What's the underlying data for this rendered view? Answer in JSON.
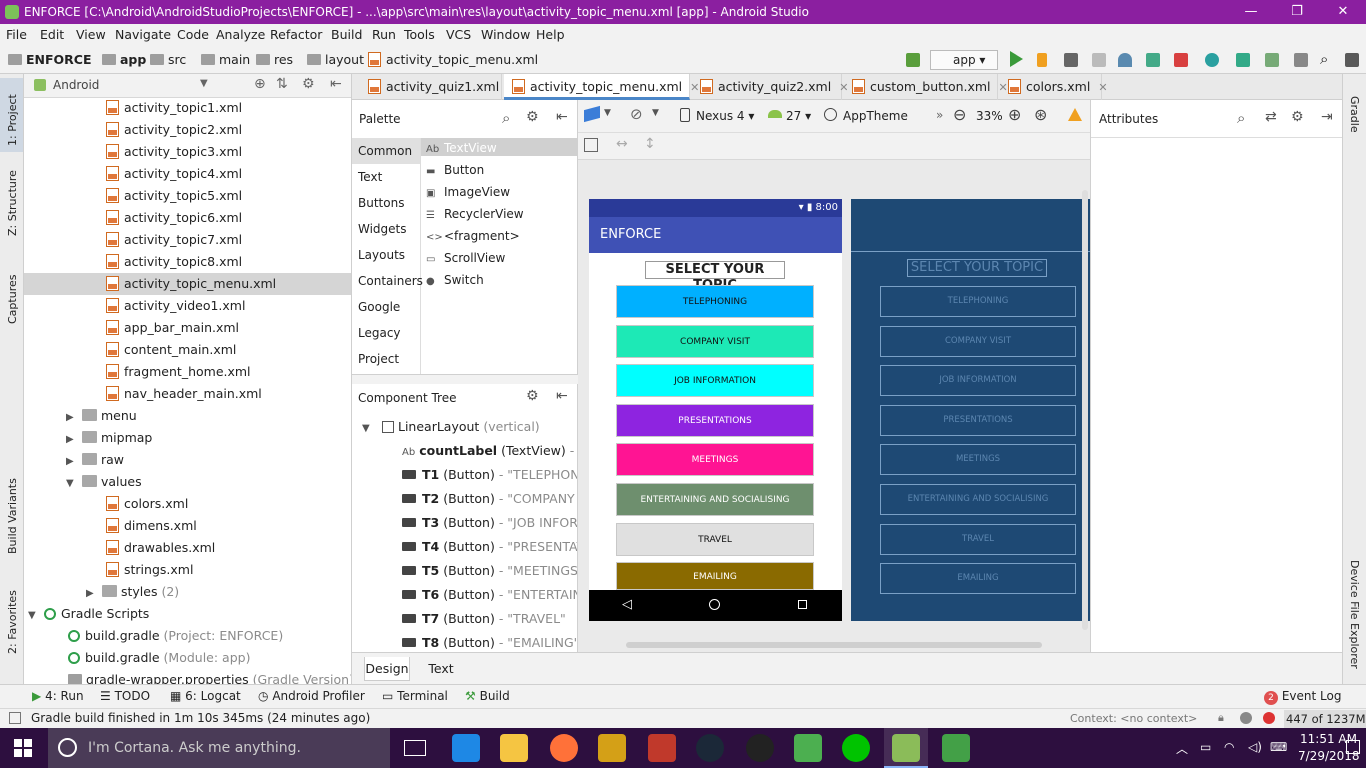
{
  "window": {
    "title": "ENFORCE [C:\\Android\\AndroidStudioProjects\\ENFORCE] - ...\\app\\src\\main\\res\\layout\\activity_topic_menu.xml [app] - Android Studio",
    "minimize": "—",
    "maximize": "❐",
    "close": "✕"
  },
  "menu": [
    "File",
    "Edit",
    "View",
    "Navigate",
    "Code",
    "Analyze",
    "Refactor",
    "Build",
    "Run",
    "Tools",
    "VCS",
    "Window",
    "Help"
  ],
  "breadcrumb": [
    "ENFORCE",
    "app",
    "src",
    "main",
    "res",
    "layout",
    "activity_topic_menu.xml"
  ],
  "run_config": "app",
  "left_strip": {
    "project": "1: Project",
    "structure": "Z: Structure",
    "captures": "Captures",
    "build_variants": "Build Variants",
    "favorites": "2: Favorites"
  },
  "right_strip": {
    "gradle": "Gradle",
    "device_explorer": "Device File Explorer"
  },
  "project": {
    "view": "Android",
    "files": [
      "activity_topic1.xml",
      "activity_topic2.xml",
      "activity_topic3.xml",
      "activity_topic4.xml",
      "activity_topic5.xml",
      "activity_topic6.xml",
      "activity_topic7.xml",
      "activity_topic8.xml",
      "activity_topic_menu.xml",
      "activity_video1.xml",
      "app_bar_main.xml",
      "content_main.xml",
      "fragment_home.xml",
      "nav_header_main.xml"
    ],
    "folders": [
      "menu",
      "mipmap",
      "raw",
      "values"
    ],
    "values_files": [
      "colors.xml",
      "dimens.xml",
      "drawables.xml",
      "strings.xml"
    ],
    "styles": "styles",
    "styles_count": "(2)",
    "gradle_scripts": "Gradle Scripts",
    "gradle_files": [
      {
        "name": "build.gradle",
        "note": "(Project: ENFORCE)"
      },
      {
        "name": "build.gradle",
        "note": "(Module: app)"
      },
      {
        "name": "gradle-wrapper.properties",
        "note": "(Gradle Version)"
      }
    ]
  },
  "tabs": [
    "activity_quiz1.xml",
    "activity_topic_menu.xml",
    "activity_quiz2.xml",
    "custom_button.xml",
    "colors.xml"
  ],
  "palette": {
    "title": "Palette",
    "categories": [
      "Common",
      "Text",
      "Buttons",
      "Widgets",
      "Layouts",
      "Containers",
      "Google",
      "Legacy",
      "Project"
    ],
    "items": [
      {
        "icon": "Ab",
        "label": "TextView"
      },
      {
        "icon": "▬",
        "label": "Button"
      },
      {
        "icon": "▣",
        "label": "ImageView"
      },
      {
        "icon": "☰",
        "label": "RecyclerView"
      },
      {
        "icon": "<>",
        "label": "<fragment>"
      },
      {
        "icon": "▭",
        "label": "ScrollView"
      },
      {
        "icon": "●",
        "label": "Switch"
      }
    ]
  },
  "component_tree": {
    "title": "Component Tree",
    "root": "LinearLayout",
    "root_note": "(vertical)",
    "label_row": {
      "name": "countLabel",
      "type": "(TextView)",
      "value": "- \"SE"
    },
    "buttons": [
      {
        "id": "T1",
        "value": "- \"TELEPHONI"
      },
      {
        "id": "T2",
        "value": "- \"COMPANY VI"
      },
      {
        "id": "T3",
        "value": "- \"JOB INFORM"
      },
      {
        "id": "T4",
        "value": "- \"PRESENTATI"
      },
      {
        "id": "T5",
        "value": "- \"MEETINGS\""
      },
      {
        "id": "T6",
        "value": "- \"ENTERTAIN"
      },
      {
        "id": "T7",
        "value": "- \"TRAVEL\""
      },
      {
        "id": "T8",
        "value": "- \"EMAILING\""
      }
    ],
    "button_type": "(Button)"
  },
  "design_toolbar": {
    "device": "Nexus 4",
    "api": "27",
    "theme": "AppTheme",
    "zoom": "33%"
  },
  "phone": {
    "time": "8:00",
    "app_name": "ENFORCE",
    "heading": "SELECT YOUR TOPIC",
    "buttons": [
      {
        "label": "TELEPHONING",
        "color": "#00b0ff",
        "text": "#111111"
      },
      {
        "label": "COMPANY VISIT",
        "color": "#1de9b6",
        "text": "#111111"
      },
      {
        "label": "JOB INFORMATION",
        "color": "#00ffff",
        "text": "#111111"
      },
      {
        "label": "PRESENTATIONS",
        "color": "#8e24e0",
        "text": "#ffffff"
      },
      {
        "label": "MEETINGS",
        "color": "#ff1493",
        "text": "#ffffff"
      },
      {
        "label": "ENTERTAINING AND SOCIALISING",
        "color": "#6e8f6e",
        "text": "#ffffff"
      },
      {
        "label": "TRAVEL",
        "color": "#e0e0e0",
        "text": "#111111"
      },
      {
        "label": "EMAILING",
        "color": "#8a6a00",
        "text": "#ffffff"
      }
    ]
  },
  "attributes": {
    "title": "Attributes"
  },
  "design_tabs": [
    "Design",
    "Text"
  ],
  "tool_windows": [
    {
      "icon": "▶",
      "label": "4: Run"
    },
    {
      "icon": "☰",
      "label": "TODO"
    },
    {
      "icon": "▦",
      "label": "6: Logcat"
    },
    {
      "icon": "◷",
      "label": "Android Profiler"
    },
    {
      "icon": "▭",
      "label": "Terminal"
    },
    {
      "icon": "⚒",
      "label": "Build"
    }
  ],
  "event_log": {
    "count": "2",
    "label": "Event Log"
  },
  "status": {
    "message": "Gradle build finished in 1m 10s 345ms (24 minutes ago)",
    "context": "Context: <no context>",
    "memory": "447 of 1237M"
  },
  "taskbar": {
    "search": "I'm Cortana. Ask me anything.",
    "time": "11:51 AM",
    "date": "7/29/2018"
  }
}
